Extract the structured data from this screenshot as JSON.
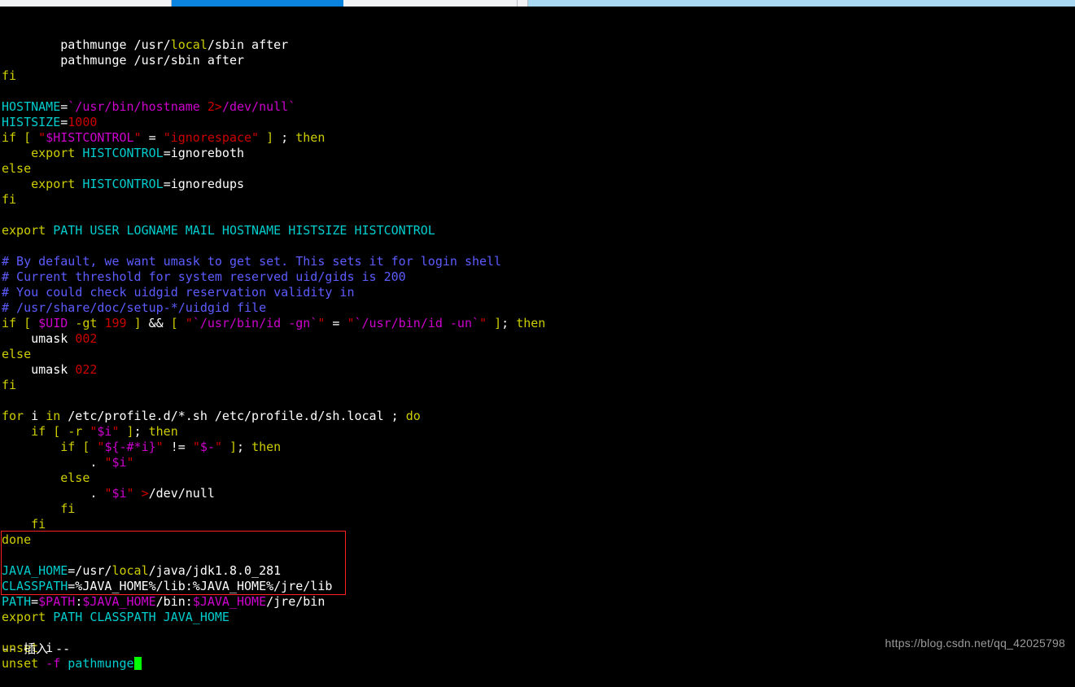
{
  "window": {
    "browser_tabs": [
      {
        "name": "tab-inactive-left",
        "state": "inactive"
      },
      {
        "name": "tab-active",
        "state": "active"
      },
      {
        "name": "tab-inactive-right",
        "state": "inactive"
      },
      {
        "name": "tab-sliver",
        "state": "inactive"
      },
      {
        "name": "tab-pale",
        "state": "pale"
      }
    ]
  },
  "editor": {
    "app": "vim",
    "mode_line": "-- 插入 --",
    "cursor": {
      "color": "#00ff00",
      "line": "unset -f pathmunge",
      "column_after": "pathmunge"
    },
    "colors": {
      "background": "#000000",
      "foreground": "#ffffff",
      "cyan": "#00cdcd",
      "yellow": "#cdcd00",
      "red": "#cd0000",
      "magenta": "#cd00cd",
      "blue": "#5c5cff",
      "cursor_green": "#00ff00",
      "highlight_box": "#ff2020"
    },
    "lines": [
      {
        "id": "l01",
        "tokens": [
          {
            "t": "        pathmunge /usr/",
            "c": "white"
          },
          {
            "t": "local",
            "c": "yellow"
          },
          {
            "t": "/sbin after",
            "c": "white"
          }
        ]
      },
      {
        "id": "l02",
        "tokens": [
          {
            "t": "        pathmunge /usr/sbin after",
            "c": "white"
          }
        ]
      },
      {
        "id": "l03",
        "tokens": [
          {
            "t": "fi",
            "c": "yellow"
          }
        ]
      },
      {
        "id": "l04",
        "tokens": [
          {
            "t": "",
            "c": "white"
          }
        ]
      },
      {
        "id": "l05",
        "tokens": [
          {
            "t": "HOSTNAME",
            "c": "cyan"
          },
          {
            "t": "=",
            "c": "white"
          },
          {
            "t": "`/usr/bin/hostname ",
            "c": "magenta"
          },
          {
            "t": "2>",
            "c": "red"
          },
          {
            "t": "/dev/null`",
            "c": "magenta"
          }
        ]
      },
      {
        "id": "l06",
        "tokens": [
          {
            "t": "HISTSIZE",
            "c": "cyan"
          },
          {
            "t": "=",
            "c": "white"
          },
          {
            "t": "1000",
            "c": "red"
          }
        ]
      },
      {
        "id": "l07",
        "tokens": [
          {
            "t": "if",
            "c": "yellow"
          },
          {
            "t": " [ ",
            "c": "yellow"
          },
          {
            "t": "\"",
            "c": "red"
          },
          {
            "t": "$HISTCONTROL",
            "c": "magenta"
          },
          {
            "t": "\"",
            "c": "red"
          },
          {
            "t": " = ",
            "c": "white"
          },
          {
            "t": "\"ignorespace\"",
            "c": "red"
          },
          {
            "t": " ",
            "c": "white"
          },
          {
            "t": "]",
            "c": "yellow"
          },
          {
            "t": " ; ",
            "c": "white"
          },
          {
            "t": "then",
            "c": "yellow"
          }
        ]
      },
      {
        "id": "l08",
        "tokens": [
          {
            "t": "    ",
            "c": "white"
          },
          {
            "t": "export",
            "c": "yellow"
          },
          {
            "t": " ",
            "c": "white"
          },
          {
            "t": "HISTCONTROL",
            "c": "cyan"
          },
          {
            "t": "=ignoreboth",
            "c": "white"
          }
        ]
      },
      {
        "id": "l09",
        "tokens": [
          {
            "t": "else",
            "c": "yellow"
          }
        ]
      },
      {
        "id": "l10",
        "tokens": [
          {
            "t": "    ",
            "c": "white"
          },
          {
            "t": "export",
            "c": "yellow"
          },
          {
            "t": " ",
            "c": "white"
          },
          {
            "t": "HISTCONTROL",
            "c": "cyan"
          },
          {
            "t": "=ignoredups",
            "c": "white"
          }
        ]
      },
      {
        "id": "l11",
        "tokens": [
          {
            "t": "fi",
            "c": "yellow"
          }
        ]
      },
      {
        "id": "l12",
        "tokens": [
          {
            "t": "",
            "c": "white"
          }
        ]
      },
      {
        "id": "l13",
        "tokens": [
          {
            "t": "export",
            "c": "yellow"
          },
          {
            "t": " ",
            "c": "white"
          },
          {
            "t": "PATH USER LOGNAME MAIL HOSTNAME HISTSIZE HISTCONTROL",
            "c": "cyan"
          }
        ]
      },
      {
        "id": "l14",
        "tokens": [
          {
            "t": "",
            "c": "white"
          }
        ]
      },
      {
        "id": "l15",
        "tokens": [
          {
            "t": "# By default, we want umask to get set. This sets it for login shell",
            "c": "blue"
          }
        ]
      },
      {
        "id": "l16",
        "tokens": [
          {
            "t": "# Current threshold for system reserved uid/gids is 200",
            "c": "blue"
          }
        ]
      },
      {
        "id": "l17",
        "tokens": [
          {
            "t": "# You could check uidgid reservation validity in",
            "c": "blue"
          }
        ]
      },
      {
        "id": "l18",
        "tokens": [
          {
            "t": "# /usr/share/doc/setup-*/uidgid file",
            "c": "blue"
          }
        ]
      },
      {
        "id": "l19",
        "tokens": [
          {
            "t": "if",
            "c": "yellow"
          },
          {
            "t": " [ ",
            "c": "yellow"
          },
          {
            "t": "$UID",
            "c": "magenta"
          },
          {
            "t": " ",
            "c": "white"
          },
          {
            "t": "-gt",
            "c": "yellow"
          },
          {
            "t": " ",
            "c": "white"
          },
          {
            "t": "199",
            "c": "red"
          },
          {
            "t": " ",
            "c": "white"
          },
          {
            "t": "]",
            "c": "yellow"
          },
          {
            "t": " ",
            "c": "white"
          },
          {
            "t": "&&",
            "c": "white"
          },
          {
            "t": " ",
            "c": "white"
          },
          {
            "t": "[",
            "c": "yellow"
          },
          {
            "t": " ",
            "c": "white"
          },
          {
            "t": "\"",
            "c": "red"
          },
          {
            "t": "`/usr/bin/id -gn`",
            "c": "magenta"
          },
          {
            "t": "\"",
            "c": "red"
          },
          {
            "t": " = ",
            "c": "white"
          },
          {
            "t": "\"",
            "c": "red"
          },
          {
            "t": "`/usr/bin/id -un`",
            "c": "magenta"
          },
          {
            "t": "\"",
            "c": "red"
          },
          {
            "t": " ",
            "c": "white"
          },
          {
            "t": "]",
            "c": "yellow"
          },
          {
            "t": "; ",
            "c": "white"
          },
          {
            "t": "then",
            "c": "yellow"
          }
        ]
      },
      {
        "id": "l20",
        "tokens": [
          {
            "t": "    umask ",
            "c": "white"
          },
          {
            "t": "002",
            "c": "red"
          }
        ]
      },
      {
        "id": "l21",
        "tokens": [
          {
            "t": "else",
            "c": "yellow"
          }
        ]
      },
      {
        "id": "l22",
        "tokens": [
          {
            "t": "    umask ",
            "c": "white"
          },
          {
            "t": "022",
            "c": "red"
          }
        ]
      },
      {
        "id": "l23",
        "tokens": [
          {
            "t": "fi",
            "c": "yellow"
          }
        ]
      },
      {
        "id": "l24",
        "tokens": [
          {
            "t": "",
            "c": "white"
          }
        ]
      },
      {
        "id": "l25",
        "tokens": [
          {
            "t": "for",
            "c": "yellow"
          },
          {
            "t": " i ",
            "c": "white"
          },
          {
            "t": "in",
            "c": "yellow"
          },
          {
            "t": " /etc/profile.d/*.sh /etc/profile.d/sh.local ; ",
            "c": "white"
          },
          {
            "t": "do",
            "c": "yellow"
          }
        ]
      },
      {
        "id": "l26",
        "tokens": [
          {
            "t": "    ",
            "c": "white"
          },
          {
            "t": "if",
            "c": "yellow"
          },
          {
            "t": " ",
            "c": "white"
          },
          {
            "t": "[",
            "c": "yellow"
          },
          {
            "t": " ",
            "c": "white"
          },
          {
            "t": "-r",
            "c": "yellow"
          },
          {
            "t": " ",
            "c": "white"
          },
          {
            "t": "\"",
            "c": "red"
          },
          {
            "t": "$i",
            "c": "magenta"
          },
          {
            "t": "\"",
            "c": "red"
          },
          {
            "t": " ",
            "c": "white"
          },
          {
            "t": "]",
            "c": "yellow"
          },
          {
            "t": "; ",
            "c": "white"
          },
          {
            "t": "then",
            "c": "yellow"
          }
        ]
      },
      {
        "id": "l27",
        "tokens": [
          {
            "t": "        ",
            "c": "white"
          },
          {
            "t": "if",
            "c": "yellow"
          },
          {
            "t": " ",
            "c": "white"
          },
          {
            "t": "[",
            "c": "yellow"
          },
          {
            "t": " ",
            "c": "white"
          },
          {
            "t": "\"",
            "c": "red"
          },
          {
            "t": "${-#*i}",
            "c": "magenta"
          },
          {
            "t": "\"",
            "c": "red"
          },
          {
            "t": " != ",
            "c": "white"
          },
          {
            "t": "\"",
            "c": "red"
          },
          {
            "t": "$-",
            "c": "magenta"
          },
          {
            "t": "\"",
            "c": "red"
          },
          {
            "t": " ",
            "c": "white"
          },
          {
            "t": "]",
            "c": "yellow"
          },
          {
            "t": "; ",
            "c": "white"
          },
          {
            "t": "then",
            "c": "yellow"
          }
        ]
      },
      {
        "id": "l28",
        "tokens": [
          {
            "t": "            . ",
            "c": "white"
          },
          {
            "t": "\"",
            "c": "red"
          },
          {
            "t": "$i",
            "c": "magenta"
          },
          {
            "t": "\"",
            "c": "red"
          }
        ]
      },
      {
        "id": "l29",
        "tokens": [
          {
            "t": "        ",
            "c": "white"
          },
          {
            "t": "else",
            "c": "yellow"
          }
        ]
      },
      {
        "id": "l30",
        "tokens": [
          {
            "t": "            . ",
            "c": "white"
          },
          {
            "t": "\"",
            "c": "red"
          },
          {
            "t": "$i",
            "c": "magenta"
          },
          {
            "t": "\"",
            "c": "red"
          },
          {
            "t": " ",
            "c": "white"
          },
          {
            "t": ">",
            "c": "red"
          },
          {
            "t": "/dev/null",
            "c": "white"
          }
        ]
      },
      {
        "id": "l31",
        "tokens": [
          {
            "t": "        ",
            "c": "white"
          },
          {
            "t": "fi",
            "c": "yellow"
          }
        ]
      },
      {
        "id": "l32",
        "tokens": [
          {
            "t": "    ",
            "c": "white"
          },
          {
            "t": "fi",
            "c": "yellow"
          }
        ]
      },
      {
        "id": "l33",
        "tokens": [
          {
            "t": "done",
            "c": "yellow"
          }
        ]
      },
      {
        "id": "l34",
        "tokens": [
          {
            "t": "",
            "c": "white"
          }
        ]
      },
      {
        "id": "l35",
        "tokens": [
          {
            "t": "JAVA_HOME",
            "c": "cyan"
          },
          {
            "t": "=/usr/",
            "c": "white"
          },
          {
            "t": "local",
            "c": "yellow"
          },
          {
            "t": "/java/jdk1.8.0_281",
            "c": "white"
          }
        ]
      },
      {
        "id": "l36",
        "tokens": [
          {
            "t": "CLASSPATH",
            "c": "cyan"
          },
          {
            "t": "=%JAVA_HOME%/lib:%JAVA_HOME%/jre/lib",
            "c": "white"
          }
        ]
      },
      {
        "id": "l37",
        "tokens": [
          {
            "t": "PATH",
            "c": "cyan"
          },
          {
            "t": "=",
            "c": "white"
          },
          {
            "t": "$PATH",
            "c": "magenta"
          },
          {
            "t": ":",
            "c": "white"
          },
          {
            "t": "$JAVA_HOME",
            "c": "magenta"
          },
          {
            "t": "/bin:",
            "c": "white"
          },
          {
            "t": "$JAVA_HOME",
            "c": "magenta"
          },
          {
            "t": "/jre/bin",
            "c": "white"
          }
        ]
      },
      {
        "id": "l38",
        "tokens": [
          {
            "t": "export",
            "c": "yellow"
          },
          {
            "t": " ",
            "c": "white"
          },
          {
            "t": "PATH CLASSPATH JAVA_HOME",
            "c": "cyan"
          }
        ]
      },
      {
        "id": "l39",
        "tokens": [
          {
            "t": "",
            "c": "white"
          }
        ]
      },
      {
        "id": "l40",
        "tokens": [
          {
            "t": "unset",
            "c": "yellow"
          },
          {
            "t": " i",
            "c": "white"
          }
        ]
      },
      {
        "id": "l41",
        "tokens": [
          {
            "t": "unset",
            "c": "yellow"
          },
          {
            "t": " ",
            "c": "white"
          },
          {
            "t": "-f",
            "c": "magenta"
          },
          {
            "t": " ",
            "c": "white"
          },
          {
            "t": "pathmunge",
            "c": "cyan"
          },
          {
            "t": "CURSOR",
            "c": "cursor"
          }
        ]
      }
    ]
  },
  "watermark": {
    "text": "https://blog.csdn.net/qq_42025798"
  }
}
